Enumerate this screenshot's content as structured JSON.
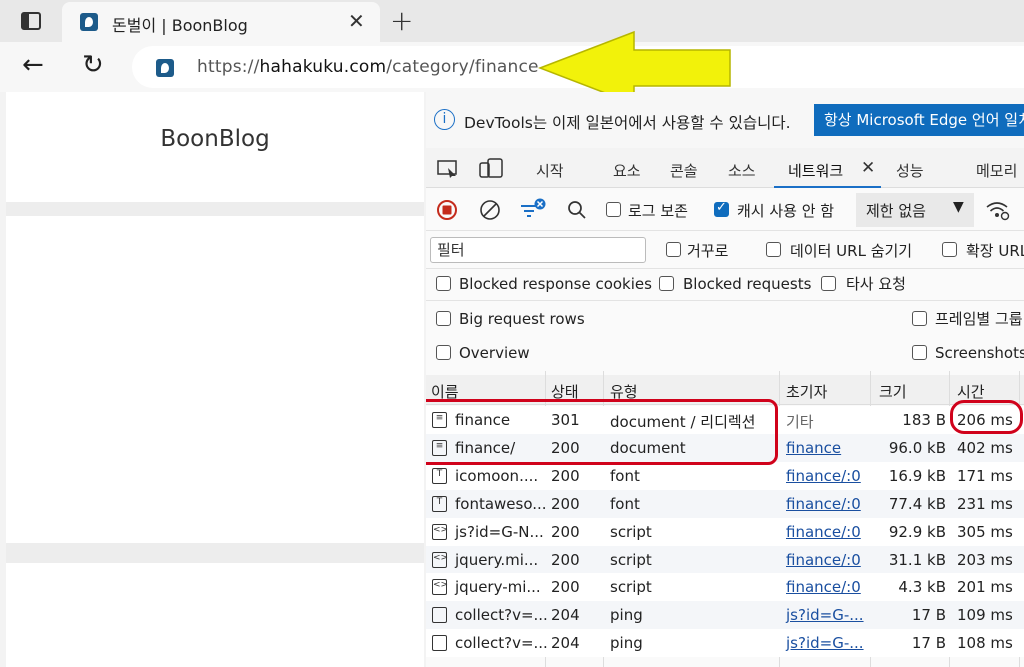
{
  "browser": {
    "tab_title": "돈벌이 | BoonBlog",
    "new_tab": "+",
    "close_tab": "✕",
    "url_prefix": "https://",
    "url_host": "hahakuku.com",
    "url_path": "/category/finance"
  },
  "page": {
    "blog_title": "BoonBlog"
  },
  "devtools": {
    "notice": "DevTools는 이제 일본어에서 사용할 수 있습니다.",
    "notice_button": "항상 Microsoft Edge 언어 일치",
    "tabs": [
      "시작",
      "요소",
      "콘솔",
      "소스",
      "네트워크",
      "성능",
      "메모리"
    ],
    "toolbar": {
      "preserve_log": "로그 보존",
      "disable_cache": "캐시 사용 안 함",
      "throttle": "제한 없음"
    },
    "filter_placeholder": "필터",
    "options": {
      "invert": "거꾸로",
      "hide_data_url": "데이터 URL 숨기기",
      "hide_ext": "확장 URL",
      "blocked_cookies": "Blocked response cookies",
      "blocked_requests": "Blocked requests",
      "third_party": "타사 요청",
      "big_rows": "Big request rows",
      "group_frame": "프레임별 그룹",
      "overview": "Overview",
      "screenshots": "Screenshots"
    },
    "columns": [
      "이름",
      "상태",
      "유형",
      "초기자",
      "크기",
      "시간"
    ],
    "rows": [
      {
        "name": "finance",
        "status": "301",
        "type": "document / 리디렉션",
        "initiator": "기타",
        "size": "183 B",
        "time": "206 ms",
        "icon": "doc",
        "link": false
      },
      {
        "name": "finance/",
        "status": "200",
        "type": "document",
        "initiator": "finance",
        "size": "96.0 kB",
        "time": "402 ms",
        "icon": "doc",
        "link": true
      },
      {
        "name": "icomoon....",
        "status": "200",
        "type": "font",
        "initiator": "finance/:0",
        "size": "16.9 kB",
        "time": "171 ms",
        "icon": "font",
        "link": true
      },
      {
        "name": "fontaweso...",
        "status": "200",
        "type": "font",
        "initiator": "finance/:0",
        "size": "77.4 kB",
        "time": "231 ms",
        "icon": "font",
        "link": true
      },
      {
        "name": "js?id=G-N...",
        "status": "200",
        "type": "script",
        "initiator": "finance/:0",
        "size": "92.9 kB",
        "time": "305 ms",
        "icon": "script",
        "link": true
      },
      {
        "name": "jquery.mi...",
        "status": "200",
        "type": "script",
        "initiator": "finance/:0",
        "size": "31.1 kB",
        "time": "203 ms",
        "icon": "script",
        "link": true
      },
      {
        "name": "jquery-mi...",
        "status": "200",
        "type": "script",
        "initiator": "finance/:0",
        "size": "4.3 kB",
        "time": "201 ms",
        "icon": "script",
        "link": true
      },
      {
        "name": "collect?v=...",
        "status": "204",
        "type": "ping",
        "initiator": "js?id=G-...",
        "size": "17 B",
        "time": "109 ms",
        "icon": "ping",
        "link": true
      },
      {
        "name": "collect?v=...",
        "status": "204",
        "type": "ping",
        "initiator": "js?id=G-...",
        "size": "17 B",
        "time": "108 ms",
        "icon": "ping",
        "link": true
      }
    ]
  },
  "colors": {
    "highlight": "#d0021b",
    "arrow": "#f2f20a",
    "accent": "#0f6cbd"
  }
}
